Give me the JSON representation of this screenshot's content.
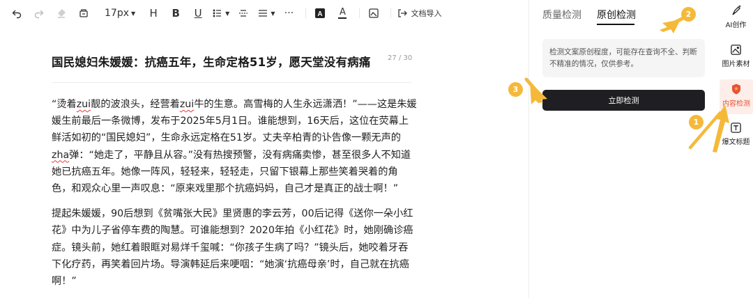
{
  "toolbar": {
    "font_size": "17px",
    "h_label": "H",
    "b_label": "B",
    "u_label": "U",
    "more_label": "···",
    "a_label": "A",
    "import_label": "文档导入"
  },
  "document": {
    "title": "国民媳妇朱媛媛：抗癌五年，生命定格51岁，愿天堂没有病痛",
    "title_count": "27 / 30",
    "p1": {
      "t1": "“烫着",
      "s1": "zui",
      "t2": "靓的波浪头，经营着",
      "s2": "zui",
      "t3": "牛的生意。高雪梅的人生永远潇洒！”——这是朱媛媛生前最后一条微博，发布于2025年5月1日。谁能想到，16天后，这位在荧幕上鲜活如初的“国民媳妇”，生命永远定格在51岁。丈夫辛柏青的讣告像一颗无声的",
      "s3": "zha",
      "t4": "弹：“她走了，平静且从容。”没有热搜预警，没有病痛卖惨，甚至很多人不知道她已抗癌五年。她像一阵风，轻轻来，轻轻走，只留下银幕上那些笑着哭着的角色，和观众心里一声叹息：“原来戏里那个抗癌妈妈，自己才是真正的战士啊！”"
    },
    "p2": "提起朱媛媛，90后想到《贫嘴张大民》里贤惠的李云芳，00后记得《送你一朵小红花》中为儿子省停车费的陶慧。可谁能想到？2020年拍《小红花》时，她刚确诊癌症。镜头前，她红着眼眶对易烊千玺喊：“你孩子生病了吗？”镜头后，她咬着牙吞下化疗药，再笑着回片场。导演韩延后来哽咽：“她演‘抗癌母亲’时，自己就在抗癌啊！”"
  },
  "panel": {
    "tab_quality": "质量检测",
    "tab_original": "原创检测",
    "notice": "检测文案原创程度，可能存在查询不全、判断不精准的情况，仅供参考。",
    "check_button": "立即检测"
  },
  "rail": {
    "ai": "AI创作",
    "image": "图片素材",
    "content": "内容检测",
    "title": "爆文标题"
  },
  "badges": {
    "one": "1",
    "two": "2",
    "three": "3"
  },
  "colors": {
    "accent": "#e5533a",
    "badge": "#f5b93a",
    "button": "#1f1f23"
  }
}
